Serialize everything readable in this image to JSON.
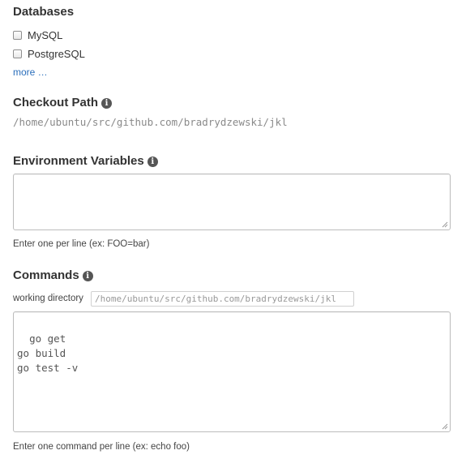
{
  "databases": {
    "title": "Databases",
    "options": [
      {
        "label": "MySQL",
        "checked": false
      },
      {
        "label": "PostgreSQL",
        "checked": false
      }
    ],
    "more_link": "more …"
  },
  "checkout_path": {
    "title": "Checkout Path",
    "info_icon": "info-icon",
    "value": "/home/ubuntu/src/github.com/bradrydzewski/jkl"
  },
  "environment_variables": {
    "title": "Environment Variables",
    "info_icon": "info-icon",
    "value": "",
    "help": "Enter one per line (ex: FOO=bar)"
  },
  "commands": {
    "title": "Commands",
    "info_icon": "info-icon",
    "working_directory_label": "working directory",
    "working_directory_value": "/home/ubuntu/src/github.com/bradrydzewski/jkl",
    "value": "go get\ngo build\ngo test -v",
    "help": "Enter one command per line (ex: echo foo)"
  }
}
